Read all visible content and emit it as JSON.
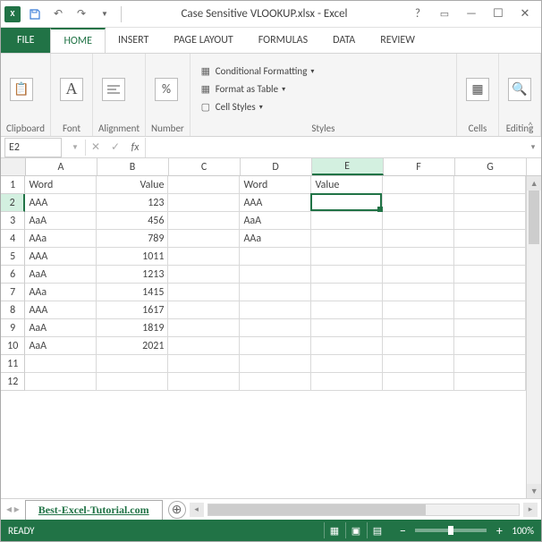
{
  "title": "Case Sensitive VLOOKUP.xlsx - Excel",
  "tabs": {
    "file": "FILE",
    "home": "HOME",
    "insert": "INSERT",
    "page_layout": "PAGE LAYOUT",
    "formulas": "FORMULAS",
    "data": "DATA",
    "review": "REVIEW"
  },
  "ribbon": {
    "clipboard": "Clipboard",
    "font": "Font",
    "font_sample": "A",
    "alignment": "Alignment",
    "number": "Number",
    "number_sample": "%",
    "styles": "Styles",
    "cond_fmt": "Conditional Formatting",
    "fmt_table": "Format as Table",
    "cell_styles": "Cell Styles",
    "cells": "Cells",
    "editing": "Editing"
  },
  "name_box": "E2",
  "columns": [
    "A",
    "B",
    "C",
    "D",
    "E",
    "F",
    "G"
  ],
  "selected_col": "E",
  "selected_row": 2,
  "rows": [
    1,
    2,
    3,
    4,
    5,
    6,
    7,
    8,
    9,
    10,
    11,
    12
  ],
  "data": {
    "1": {
      "A": "Word",
      "B": "Value",
      "D": "Word",
      "E": "Value"
    },
    "2": {
      "A": "AAA",
      "B": "123",
      "D": "AAA"
    },
    "3": {
      "A": "AaA",
      "B": "456",
      "D": "AaA"
    },
    "4": {
      "A": "AAa",
      "B": "789",
      "D": "AAa"
    },
    "5": {
      "A": "AAA",
      "B": "1011"
    },
    "6": {
      "A": "AaA",
      "B": "1213"
    },
    "7": {
      "A": "AAa",
      "B": "1415"
    },
    "8": {
      "A": "AAA",
      "B": "1617"
    },
    "9": {
      "A": "AaA",
      "B": "1819"
    },
    "10": {
      "A": "AaA",
      "B": "2021"
    }
  },
  "numeric_cols": [
    "B"
  ],
  "sheet": "Best-Excel-Tutorial.com",
  "status": "READY",
  "zoom": "100%"
}
